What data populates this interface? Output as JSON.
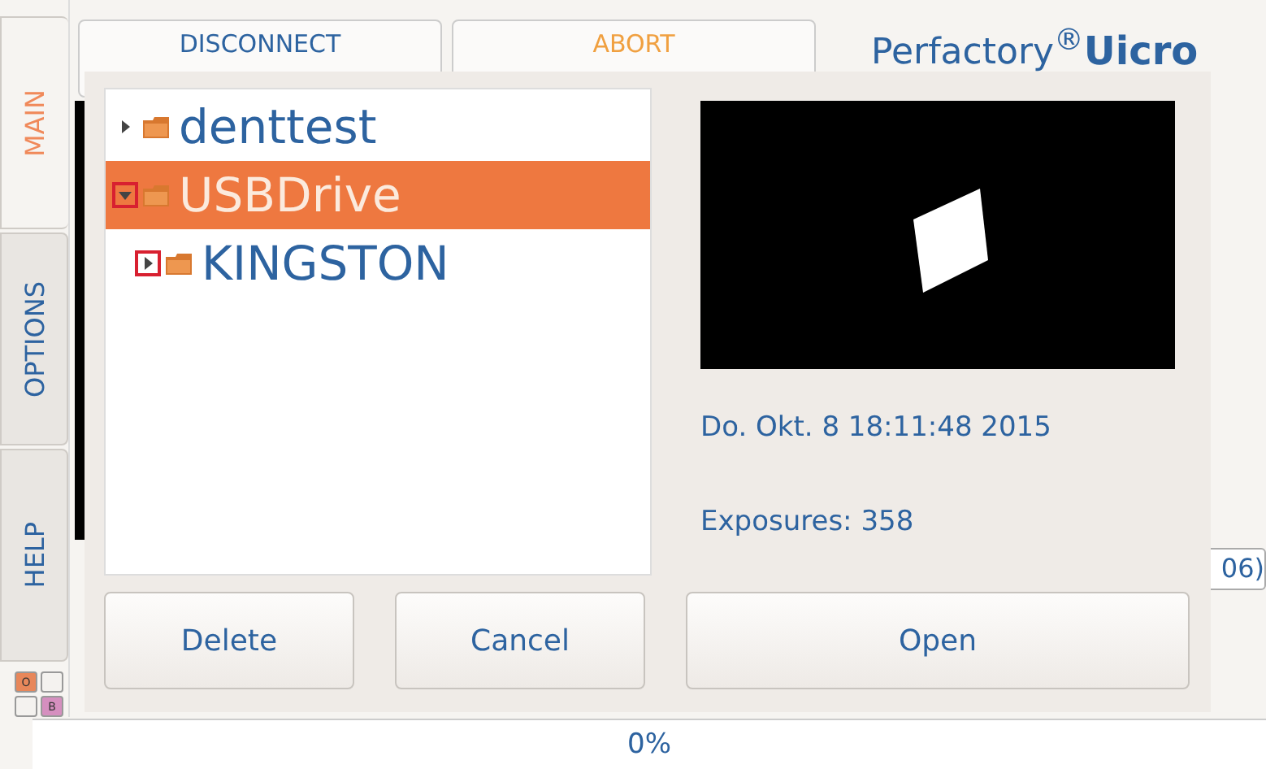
{
  "side_tabs": [
    {
      "label": "MAIN",
      "selected": true
    },
    {
      "label": "OPTIONS",
      "selected": false
    },
    {
      "label": "HELP",
      "selected": false
    }
  ],
  "mode_keys": [
    {
      "label": "O",
      "color": "#e8875a"
    },
    {
      "color": "#f4f2ef"
    },
    {
      "color": "#f4f2ef"
    },
    {
      "label": "B",
      "color": "#d58fbf"
    }
  ],
  "top_buttons": [
    {
      "label": "DISCONNECT",
      "kind": "normal"
    },
    {
      "label": "ABORT",
      "kind": "warning"
    }
  ],
  "logo": {
    "text": "Perfactory$^{®}$",
    "bold": "Uicro"
  },
  "side_field": {
    "value": "06)"
  },
  "dialog": {
    "tree": [
      {
        "label": "denttest",
        "expanded": false,
        "selected": false,
        "outlined": false
      },
      {
        "label": "USBDrive",
        "expanded": true,
        "selected": true,
        "outlined": true,
        "children": [
          {
            "label": "KINGSTON",
            "expanded": false,
            "selected": false,
            "outlined": true
          }
        ]
      }
    ],
    "preview": {
      "kind": "picture"
    },
    "date": "Do. Okt. 8 18:11:48 2015",
    "exposures": "Exposures: 358",
    "buttons": [
      "Delete",
      "Cancel",
      "Open"
    ]
  },
  "status_bar": {
    "progress": "0%"
  }
}
